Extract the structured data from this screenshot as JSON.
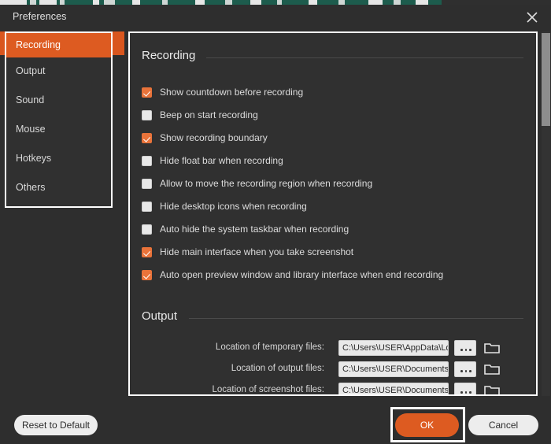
{
  "window": {
    "title": "Preferences",
    "close_icon": "close-icon"
  },
  "colors": {
    "accent_orange": "#dd5b21",
    "checkbox_orange": "#e9733a",
    "panel_bg": "#303030",
    "window_bg": "#2e2e2e",
    "highlight_white": "#ffffff"
  },
  "sidebar": {
    "items": [
      {
        "label": "Recording",
        "active": true
      },
      {
        "label": "Output",
        "active": false
      },
      {
        "label": "Sound",
        "active": false
      },
      {
        "label": "Mouse",
        "active": false
      },
      {
        "label": "Hotkeys",
        "active": false
      },
      {
        "label": "Others",
        "active": false
      }
    ]
  },
  "main": {
    "sections": [
      {
        "title": "Recording"
      },
      {
        "title": "Output"
      }
    ],
    "recording": {
      "title": "Recording",
      "options": [
        {
          "label": "Show countdown before recording",
          "checked": true
        },
        {
          "label": "Beep on start recording",
          "checked": false
        },
        {
          "label": "Show recording boundary",
          "checked": true
        },
        {
          "label": "Hide float bar when recording",
          "checked": false
        },
        {
          "label": "Allow to move the recording region when recording",
          "checked": false
        },
        {
          "label": "Hide desktop icons when recording",
          "checked": false
        },
        {
          "label": "Auto hide the system taskbar when recording",
          "checked": false
        },
        {
          "label": "Hide main interface when you take screenshot",
          "checked": true
        },
        {
          "label": "Auto open preview window and library interface when end recording",
          "checked": true
        }
      ]
    },
    "output": {
      "title": "Output",
      "rows": [
        {
          "label": "Location of temporary files:",
          "value": "C:\\Users\\USER\\AppData\\Local\\Ten",
          "browse_label": "...",
          "folder_icon": "folder-icon"
        },
        {
          "label": "Location of output files:",
          "value": "C:\\Users\\USER\\Documents\\Aiseesc",
          "browse_label": "...",
          "folder_icon": "folder-icon"
        },
        {
          "label": "Location of screenshot files:",
          "value": "C:\\Users\\USER\\Documents\\Aiseesc",
          "browse_label": "...",
          "folder_icon": "folder-icon"
        }
      ]
    }
  },
  "footer": {
    "reset_label": "Reset to Default",
    "ok_label": "OK",
    "cancel_label": "Cancel"
  },
  "scrollbar": {
    "name": "vertical-scrollbar"
  }
}
